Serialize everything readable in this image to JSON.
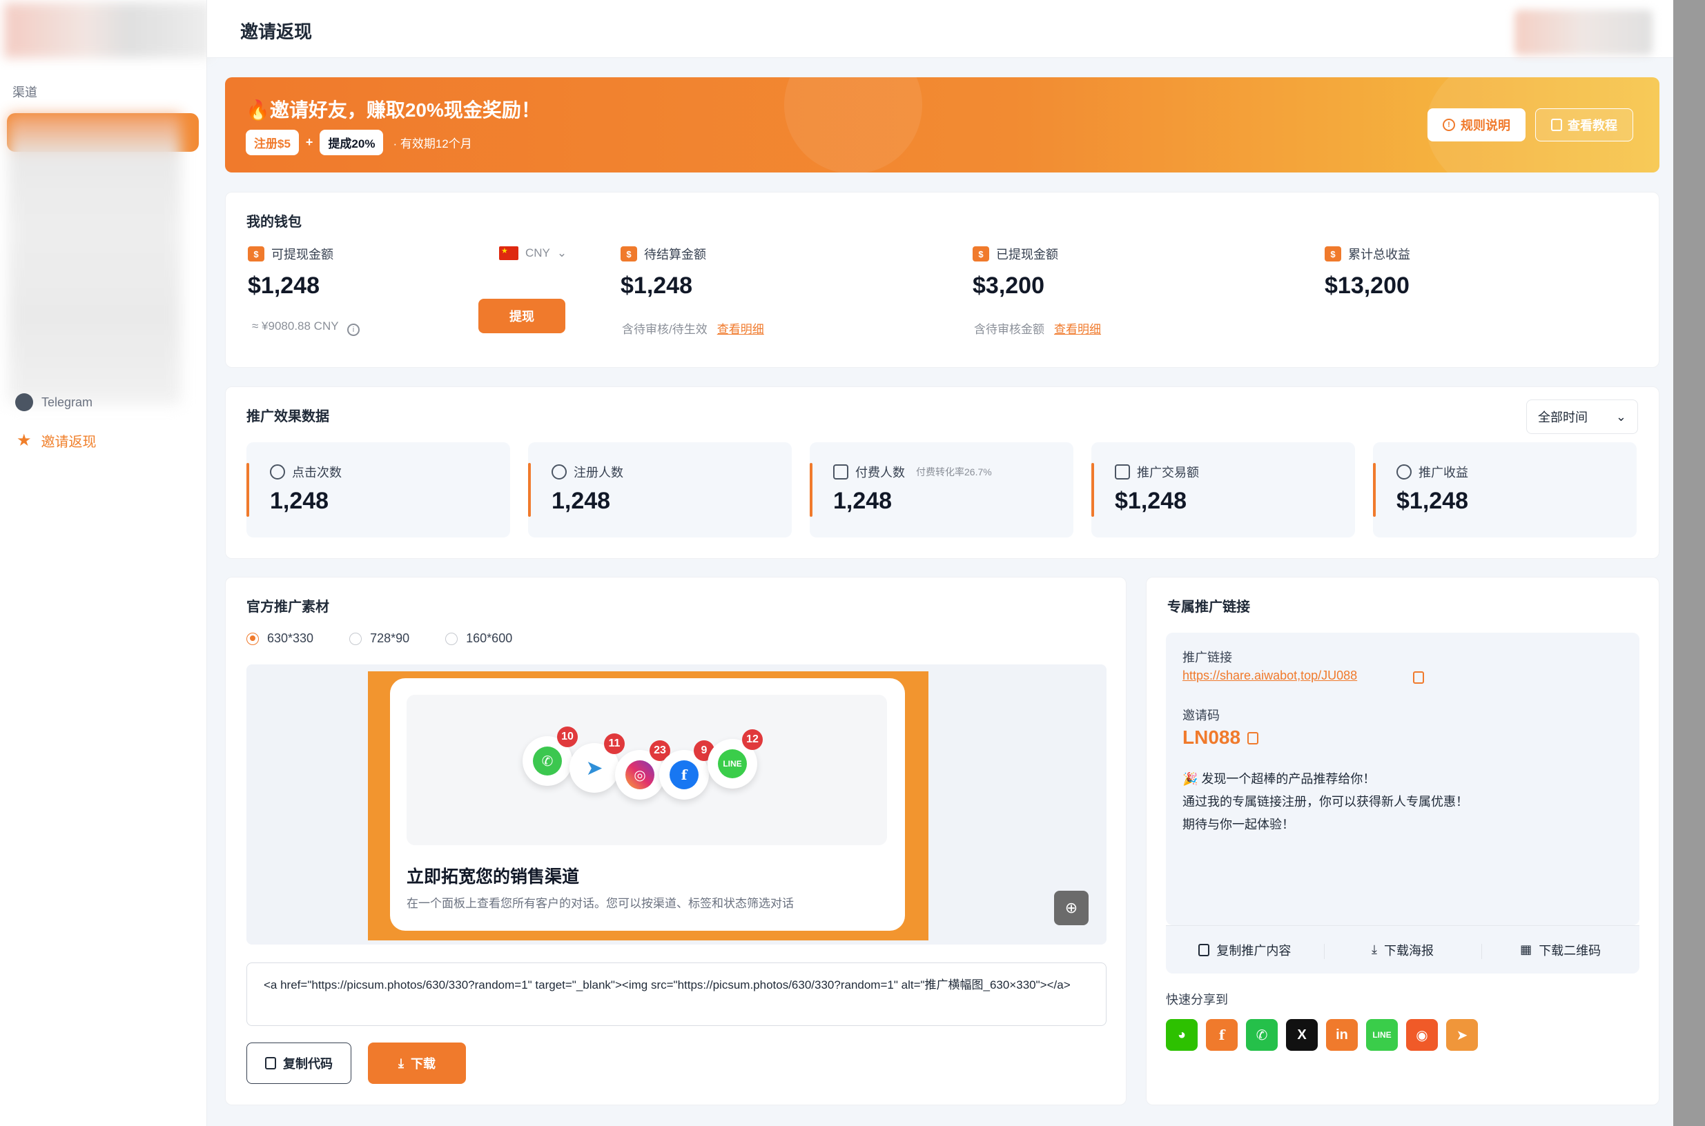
{
  "sidebar": {
    "section_label": "渠道",
    "telegram_label": "Telegram",
    "active_item": "邀请返现"
  },
  "header": {
    "title": "邀请返现"
  },
  "banner": {
    "title": "🔥邀请好友，赚取20%现金奖励！",
    "chip_register": "注册$5",
    "plus": "+",
    "chip_commission": "提成20%",
    "validity": "· 有效期12个月",
    "rules_button": "规则说明",
    "tutorial_button": "查看教程"
  },
  "wallet": {
    "title": "我的钱包",
    "withdrawable": {
      "label": "可提现金额",
      "amount": "$1,248",
      "approx": "≈ ¥9080.88 CNY"
    },
    "currency": "CNY",
    "withdraw_button": "提现",
    "pending": {
      "label": "待结算金额",
      "amount": "$1,248",
      "note": "含待审核/待生效",
      "link": "查看明细"
    },
    "withdrawn": {
      "label": "已提现金额",
      "amount": "$3,200",
      "note": "含待审核金额",
      "link": "查看明细"
    },
    "total": {
      "label": "累计总收益",
      "amount": "$13,200"
    }
  },
  "stats": {
    "title": "推广效果数据",
    "time_filter": "全部时间",
    "items": [
      {
        "label": "点击次数",
        "value": "1,248",
        "note": ""
      },
      {
        "label": "注册人数",
        "value": "1,248",
        "note": ""
      },
      {
        "label": "付费人数",
        "value": "1,248",
        "note": "付费转化率26.7%"
      },
      {
        "label": "推广交易额",
        "value": "$1,248",
        "note": ""
      },
      {
        "label": "推广收益",
        "value": "$1,248",
        "note": ""
      }
    ]
  },
  "materials": {
    "title": "官方推广素材",
    "sizes": [
      "630*330",
      "728*90",
      "160*600"
    ],
    "selected_size": "630*330",
    "preview": {
      "badges": [
        "10",
        "11",
        "23",
        "9",
        "12"
      ],
      "app_labels": {
        "line": "LINE",
        "facebook": "f"
      },
      "title": "立即拓宽您的销售渠道",
      "desc": "在一个面板上查看您所有客户的对话。您可以按渠道、标签和状态筛选对话"
    },
    "code": "<a href=\"https://picsum.photos/630/330?random=1\" target=\"_blank\"><img src=\"https://picsum.photos/630/330?random=1\" alt=\"推广横幅图_630×330\"></a>",
    "copy_button": "复制代码",
    "download_button": "下载"
  },
  "link_card": {
    "title": "专属推广链接",
    "link_label": "推广链接",
    "link_url": "https://share.aiwabot,top/JU088",
    "code_label": "邀请码",
    "invite_code": "LN088",
    "message_lines": [
      "🎉 发现一个超棒的产品推荐给你！",
      "通过我的专属链接注册，你可以获得新人专属优惠！",
      "期待与你一起体验！"
    ],
    "actions": [
      "复制推广内容",
      "下载海报",
      "下载二维码"
    ],
    "share_label": "快速分享到",
    "share_icons": {
      "facebook": "f",
      "x": "X",
      "linkedin": "in",
      "line": "LINE"
    }
  },
  "colors": {
    "accent": "#f07a2c",
    "badge": "#e0393c"
  }
}
